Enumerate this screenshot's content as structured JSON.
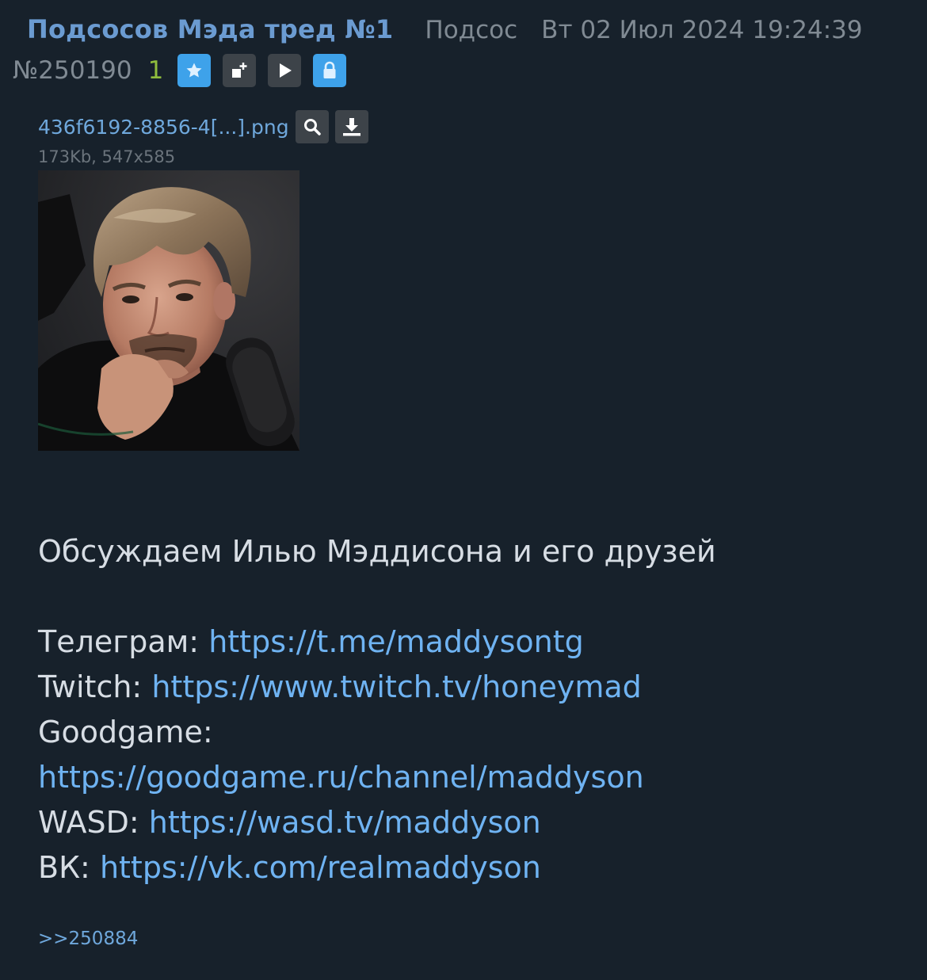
{
  "post": {
    "subject": "Подсосов Мэда тред №1",
    "author": "Подсос",
    "datetime": "Вт 02 Июл 2024 19:24:39",
    "number": "№250190",
    "reply_count": "1"
  },
  "icons": {
    "favorite": "star-icon",
    "add_to_list": "add-icon",
    "play": "play-icon",
    "lock": "lock-icon",
    "search": "search-icon",
    "download": "download-icon"
  },
  "file": {
    "name": "436f6192-8856-4[...].png",
    "info": "173Kb, 547x585"
  },
  "message": {
    "intro": "Обсуждаем Илью Мэддисона и его друзей",
    "links": [
      {
        "label": "Телеграм:",
        "url": "https://t.me/maddysontg"
      },
      {
        "label": "Twitch:",
        "url": "https://www.twitch.tv/honeymad"
      },
      {
        "label": "Goodgame:",
        "url": "https://goodgame.ru/channel/maddyson"
      },
      {
        "label": "WASD:",
        "url": "https://wasd.tv/maddyson"
      },
      {
        "label": "ВК:",
        "url": "https://vk.com/realmaddyson"
      }
    ]
  },
  "replies": [
    ">>250884"
  ],
  "colors": {
    "background": "#17212b",
    "subject": "#6b9bd1",
    "link": "#6fb3f2",
    "meta": "#808a93",
    "reply_count": "#8fbd3d",
    "accent_button": "#3ea2ea"
  }
}
